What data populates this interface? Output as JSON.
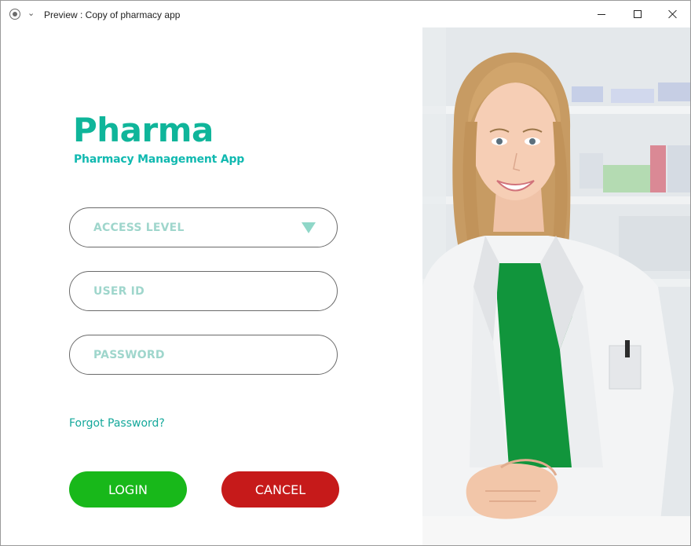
{
  "window": {
    "title": "Preview : Copy of pharmacy app"
  },
  "icons": {
    "app": "record-circle-icon",
    "menu": "chevron-down-icon",
    "minimize": "minimize-icon",
    "maximize": "maximize-icon",
    "close": "close-icon",
    "dropdown": "triangle-down-icon"
  },
  "brand": {
    "name": "Pharma",
    "tagline": "Pharmacy Management App"
  },
  "form": {
    "access_level_placeholder": "ACCESS LEVEL",
    "user_id_placeholder": "USER ID",
    "password_placeholder": "PASSWORD",
    "forgot_password": "Forgot Password?",
    "login_label": "LOGIN",
    "cancel_label": "CANCEL"
  },
  "colors": {
    "brand": "#0fb59a",
    "tagline": "#11b9b0",
    "placeholder": "#9fd6cc",
    "login": "#18b81a",
    "cancel": "#c61a1a"
  }
}
